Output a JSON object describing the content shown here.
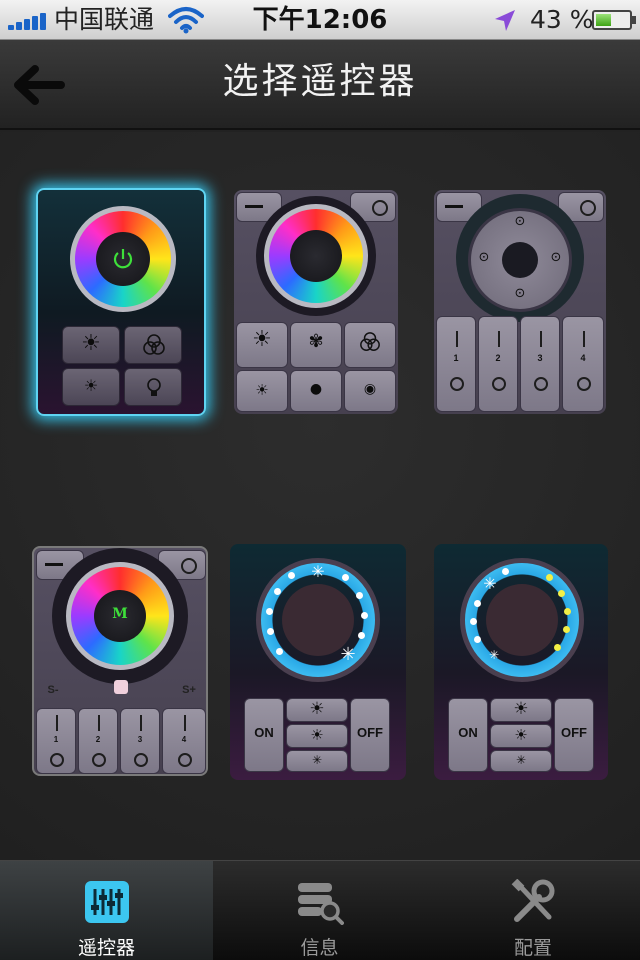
{
  "status_bar": {
    "carrier": "中国联通",
    "time": "下午12:06",
    "battery": "43 %",
    "battery_level": 0.43
  },
  "nav": {
    "title": "选择遥控器",
    "back_icon": "arrow-left-icon"
  },
  "remotes": [
    {
      "id": "rgb-wheel-4key",
      "selected": true
    },
    {
      "id": "rgb-wheel-6key",
      "selected": false
    },
    {
      "id": "dpad-4zone",
      "selected": false
    },
    {
      "id": "rgb-wheel-mode-4zone",
      "selected": false,
      "center_label": "M",
      "minus_label": "S-",
      "plus_label": "S+",
      "zones": [
        "1",
        "2",
        "3",
        "4"
      ]
    },
    {
      "id": "white-ring-a",
      "selected": false,
      "on_label": "ON",
      "off_label": "OFF"
    },
    {
      "id": "cct-ring-b",
      "selected": false,
      "on_label": "ON",
      "off_label": "OFF"
    }
  ],
  "remote_misc": {
    "dpad_zones": [
      "1",
      "2",
      "3",
      "4"
    ]
  },
  "tabs": [
    {
      "label": "遥控器",
      "icon": "sliders-icon",
      "active": true
    },
    {
      "label": "信息",
      "icon": "database-search-icon",
      "active": false
    },
    {
      "label": "配置",
      "icon": "tools-icon",
      "active": false
    }
  ],
  "colors": {
    "accent": "#35c0e6",
    "ring_blue": "#2aa8e6",
    "tab_active_icon": "#3cc6f0"
  }
}
